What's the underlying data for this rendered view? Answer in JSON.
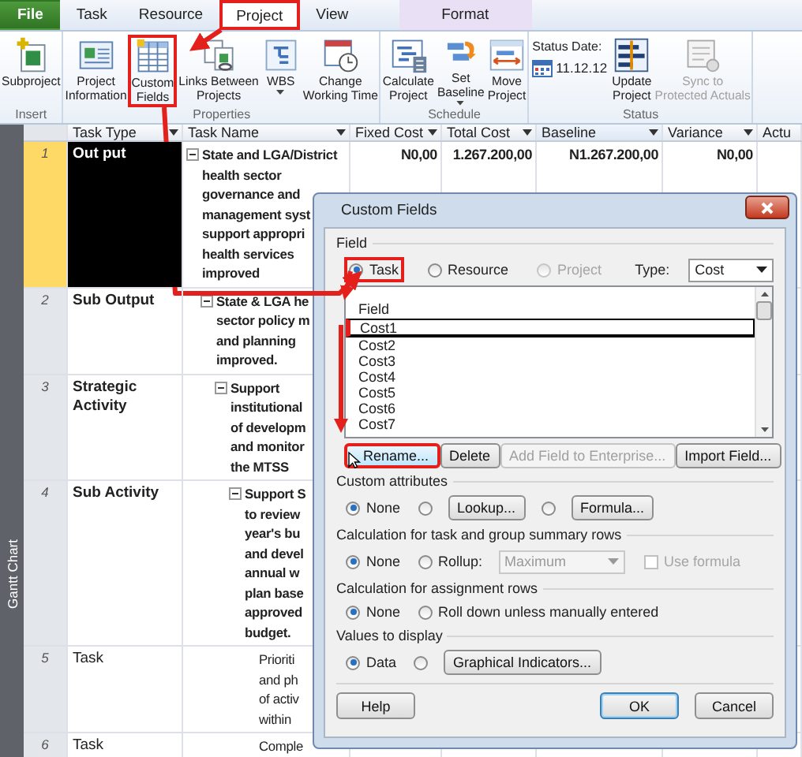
{
  "tabs": [
    {
      "label": "File",
      "kind": "file",
      "selected": false,
      "highlighted": false
    },
    {
      "label": "Task",
      "kind": "plain",
      "selected": false,
      "highlighted": false
    },
    {
      "label": "Resource",
      "kind": "plain",
      "selected": false,
      "highlighted": false
    },
    {
      "label": "Project",
      "kind": "plain",
      "selected": true,
      "highlighted": true
    },
    {
      "label": "View",
      "kind": "plain",
      "selected": false,
      "highlighted": false
    },
    {
      "label": "Format",
      "kind": "contextual",
      "selected": false,
      "highlighted": false
    }
  ],
  "ribbon_groups": [
    {
      "label": "Insert",
      "buttons": [
        {
          "label": "Subproject",
          "highlighted": false,
          "disabled": false,
          "dropdown": false
        }
      ]
    },
    {
      "label": "Properties",
      "buttons": [
        {
          "label": "Project\nInformation",
          "highlighted": false,
          "disabled": false,
          "dropdown": false
        },
        {
          "label": "Custom\nFields",
          "highlighted": true,
          "disabled": false,
          "dropdown": false
        },
        {
          "label": "Links Between\nProjects",
          "highlighted": false,
          "disabled": false,
          "dropdown": false
        },
        {
          "label": "WBS",
          "highlighted": false,
          "disabled": false,
          "dropdown": true
        },
        {
          "label": "Change\nWorking Time",
          "highlighted": false,
          "disabled": false,
          "dropdown": false
        }
      ]
    },
    {
      "label": "Schedule",
      "buttons": [
        {
          "label": "Calculate\nProject",
          "highlighted": false,
          "disabled": false,
          "dropdown": false
        },
        {
          "label": "Set\nBaseline",
          "highlighted": false,
          "disabled": false,
          "dropdown": true
        },
        {
          "label": "Move\nProject",
          "highlighted": false,
          "disabled": false,
          "dropdown": false
        }
      ]
    },
    {
      "label": "Status",
      "status_date": {
        "label": "Status Date:",
        "value": "11.12.12"
      },
      "buttons": [
        {
          "label": "Update\nProject",
          "highlighted": false,
          "disabled": false,
          "dropdown": false
        },
        {
          "label": "Sync to\nProtected Actuals",
          "highlighted": false,
          "disabled": true,
          "dropdown": false
        }
      ]
    }
  ],
  "side_label": "Gantt Chart",
  "table": {
    "columns": [
      "Task Type",
      "Task Name",
      "Fixed Cost",
      "Total Cost",
      "Baseline",
      "Variance",
      "Actu"
    ],
    "rows": [
      {
        "number": "1",
        "task_type": "Out put",
        "selected": true,
        "expanded": true,
        "name_lines": [
          "State and LGA/District",
          "health sector",
          "governance and",
          "management syst",
          "support appropri",
          "health services",
          "improved"
        ],
        "costs": [
          "N0,00",
          "1.267.200,00",
          "N1.267.200,00",
          "N0,00"
        ],
        "children": [
          {
            "number": "2",
            "task_type": "Sub Output",
            "selected": false,
            "expanded": true,
            "name_lines": [
              "State & LGA he",
              "sector policy m",
              "and planning",
              "improved."
            ],
            "children": [
              {
                "number": "3",
                "task_type": "Strategic Activity",
                "selected": false,
                "expanded": true,
                "name_lines": [
                  "Support",
                  "institutional",
                  "of developm",
                  "and monitor",
                  "the MTSS"
                ],
                "children": [
                  {
                    "number": "4",
                    "task_type": "Sub Activity",
                    "selected": false,
                    "expanded": true,
                    "name_lines": [
                      "Support S",
                      "to review",
                      "year's bu",
                      "and devel",
                      "annual w",
                      "plan base",
                      "approved",
                      "budget."
                    ],
                    "children": [
                      {
                        "number": "5",
                        "task_type": "Task",
                        "selected": false,
                        "name_lines": [
                          "Prioriti",
                          "and ph",
                          "of activ",
                          "within"
                        ]
                      },
                      {
                        "number": "6",
                        "task_type": "Task",
                        "selected": false,
                        "name_lines": [
                          "Comple"
                        ]
                      }
                    ]
                  }
                ]
              }
            ]
          }
        ]
      }
    ]
  },
  "dialog": {
    "title": "Custom Fields",
    "field_group": {
      "label": "Field",
      "options": [
        {
          "label": "Task",
          "selected": true,
          "disabled": false,
          "highlighted": true
        },
        {
          "label": "Resource",
          "selected": false,
          "disabled": false,
          "highlighted": false
        },
        {
          "label": "Project",
          "selected": false,
          "disabled": true,
          "highlighted": false
        }
      ],
      "type_label": "Type:",
      "type_value": "Cost"
    },
    "field_list": {
      "header": "Field",
      "items": [
        {
          "label": "Cost1",
          "selected": true,
          "highlighted": true
        },
        {
          "label": "Cost2",
          "selected": false,
          "highlighted": false
        },
        {
          "label": "Cost3",
          "selected": false,
          "highlighted": false
        },
        {
          "label": "Cost4",
          "selected": false,
          "highlighted": false
        },
        {
          "label": "Cost5",
          "selected": false,
          "highlighted": false
        },
        {
          "label": "Cost6",
          "selected": false,
          "highlighted": false
        },
        {
          "label": "Cost7",
          "selected": false,
          "highlighted": false
        }
      ]
    },
    "field_buttons": [
      {
        "label": "Rename...",
        "highlighted": true,
        "hover": true,
        "disabled": false
      },
      {
        "label": "Delete",
        "highlighted": false,
        "hover": false,
        "disabled": false
      },
      {
        "label": "Add Field to Enterprise...",
        "highlighted": false,
        "hover": false,
        "disabled": true
      },
      {
        "label": "Import Field...",
        "highlighted": false,
        "hover": false,
        "disabled": false
      }
    ],
    "sections": [
      {
        "label": "Custom attributes",
        "controls": [
          {
            "kind": "radio",
            "label": "None",
            "selected": true,
            "disabled": false
          },
          {
            "kind": "radio",
            "selected": false,
            "disabled": false
          },
          {
            "kind": "button",
            "label": "Lookup...",
            "disabled": false
          },
          {
            "kind": "radio",
            "selected": false,
            "disabled": false
          },
          {
            "kind": "button",
            "label": "Formula...",
            "disabled": false
          }
        ]
      },
      {
        "label": "Calculation for task and group summary rows",
        "controls": [
          {
            "kind": "radio",
            "label": "None",
            "selected": true,
            "disabled": false
          },
          {
            "kind": "radio",
            "label": "Rollup:",
            "selected": false,
            "disabled": false
          },
          {
            "kind": "select",
            "label": "Maximum",
            "disabled": true
          },
          {
            "kind": "checkbox",
            "label": "Use formula",
            "checked": false,
            "disabled": true
          }
        ]
      },
      {
        "label": "Calculation for assignment rows",
        "controls": [
          {
            "kind": "radio",
            "label": "None",
            "selected": true,
            "disabled": false
          },
          {
            "kind": "radio",
            "label": "Roll down unless manually entered",
            "selected": false,
            "disabled": false
          }
        ]
      },
      {
        "label": "Values to display",
        "controls": [
          {
            "kind": "radio",
            "label": "Data",
            "selected": true,
            "disabled": false
          },
          {
            "kind": "radio",
            "selected": false,
            "disabled": false
          },
          {
            "kind": "button",
            "label": "Graphical Indicators...",
            "disabled": false
          }
        ]
      }
    ],
    "footer_buttons": [
      {
        "label": "Help",
        "default": false
      },
      {
        "label": "OK",
        "default": true
      },
      {
        "label": "Cancel",
        "default": false
      }
    ]
  }
}
